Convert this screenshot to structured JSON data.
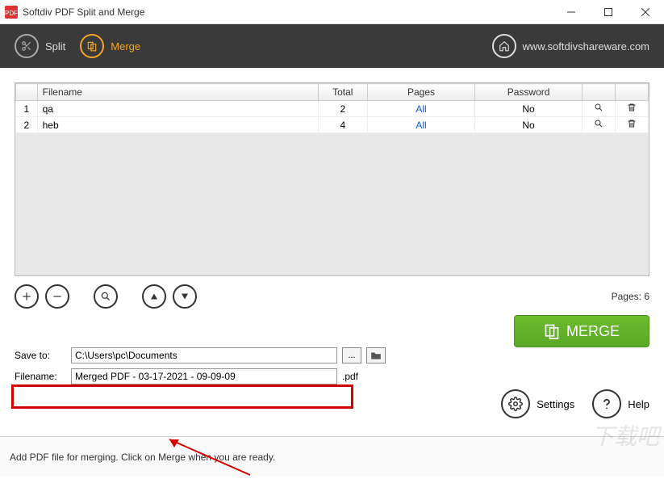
{
  "window": {
    "title": "Softdiv PDF Split and Merge"
  },
  "toolbar": {
    "split_label": "Split",
    "merge_label": "Merge",
    "url": "www.softdivshareware.com"
  },
  "table": {
    "headers": {
      "idx": "",
      "filename": "Filename",
      "total": "Total",
      "pages": "Pages",
      "password": "Password",
      "view": "",
      "delete": ""
    },
    "rows": [
      {
        "idx": "1",
        "filename": "qa",
        "total": "2",
        "pages": "All",
        "password": "No"
      },
      {
        "idx": "2",
        "filename": "heb",
        "total": "4",
        "pages": "All",
        "password": "No"
      }
    ]
  },
  "pages_summary": "Pages: 6",
  "save": {
    "label": "Save to:",
    "path": "C:\\Users\\pc\\Documents",
    "dots": "..."
  },
  "filename": {
    "label": "Filename:",
    "value": "Merged PDF - 03-17-2021 - 09-09-09",
    "ext": ".pdf"
  },
  "merge_button": "MERGE",
  "right": {
    "settings": "Settings",
    "help": "Help"
  },
  "status": "Add PDF file for merging. Click on Merge when you are ready.",
  "watermark": "下载吧"
}
